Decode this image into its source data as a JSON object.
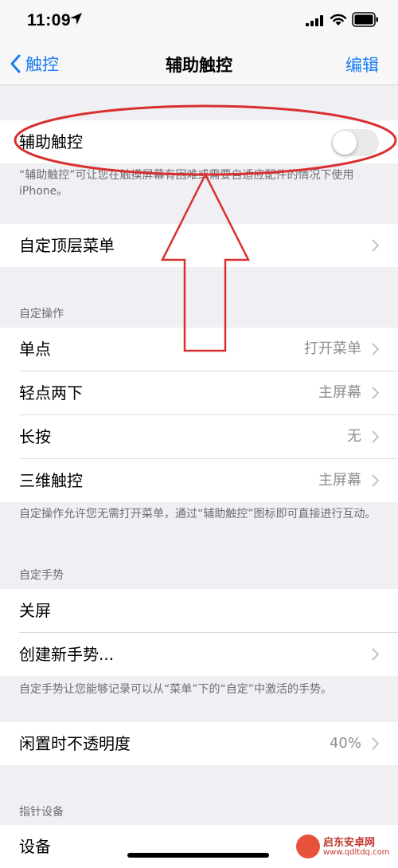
{
  "status": {
    "time": "11:09"
  },
  "nav": {
    "back_label": "触控",
    "title": "辅助触控",
    "edit_label": "编辑"
  },
  "assistive_touch": {
    "label": "辅助触控",
    "enabled": false,
    "description": "“辅助触控”可让您在触摸屏幕有困难或需要自适应配件的情况下使用iPhone。"
  },
  "customize_top_menu": {
    "label": "自定顶层菜单"
  },
  "custom_actions": {
    "header": "自定操作",
    "items": [
      {
        "label": "单点",
        "value": "打开菜单"
      },
      {
        "label": "轻点两下",
        "value": "主屏幕"
      },
      {
        "label": "长按",
        "value": "无"
      },
      {
        "label": "三维触控",
        "value": "主屏幕"
      }
    ],
    "footnote": "自定操作允许您无需打开菜单，通过“辅助触控”图标即可直接进行互动。"
  },
  "custom_gestures": {
    "header": "自定手势",
    "items": [
      {
        "label": "关屏"
      },
      {
        "label": "创建新手势..."
      }
    ],
    "footnote": "自定手势让您能够记录可以从“菜单”下的“自定”中激活的手势。"
  },
  "idle_opacity": {
    "label": "闲置时不透明度",
    "value": "40%"
  },
  "pointer_devices": {
    "header": "指针设备",
    "devices_label": "设备"
  },
  "watermark": {
    "title": "启东安卓网",
    "url": "www.qdltdq.com"
  },
  "colors": {
    "accent": "#1a7cf2",
    "annotation": "#d9302f",
    "background": "#efeff4"
  }
}
